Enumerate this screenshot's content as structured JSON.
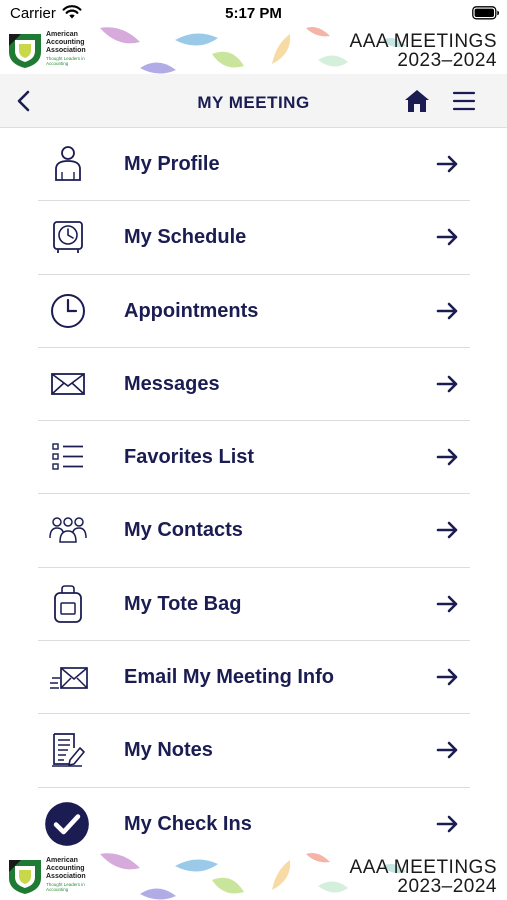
{
  "status_bar": {
    "carrier": "Carrier",
    "time": "5:17 PM"
  },
  "banner": {
    "org_name": "American Accounting Association",
    "org_tagline": "Thought Leaders in Accounting",
    "title_line1": "AAA MEETINGS",
    "title_line2": "2023–2024"
  },
  "nav": {
    "title": "MY MEETING"
  },
  "menu": {
    "items": [
      {
        "label": "My Profile",
        "icon": "person-icon"
      },
      {
        "label": "My Schedule",
        "icon": "clock-box-icon"
      },
      {
        "label": "Appointments",
        "icon": "clock-icon"
      },
      {
        "label": "Messages",
        "icon": "envelope-icon"
      },
      {
        "label": "Favorites List",
        "icon": "checklist-icon"
      },
      {
        "label": "My Contacts",
        "icon": "contacts-group-icon"
      },
      {
        "label": "My Tote Bag",
        "icon": "tote-bag-icon"
      },
      {
        "label": "Email My Meeting Info",
        "icon": "email-send-icon"
      },
      {
        "label": "My Notes",
        "icon": "notes-icon"
      },
      {
        "label": "My Check Ins",
        "icon": "check-circle-icon"
      }
    ]
  },
  "colors": {
    "navy": "#1b1d52",
    "nav_bg": "#f4f4f5",
    "divider": "#dcdcdc"
  }
}
